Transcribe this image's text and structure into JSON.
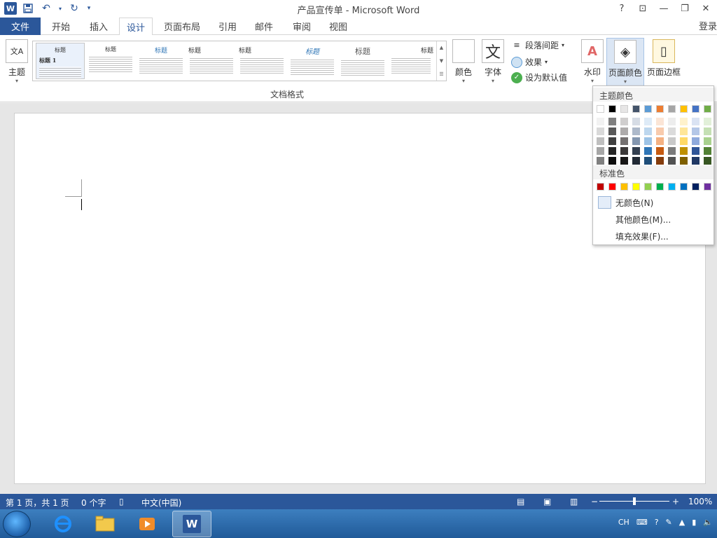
{
  "titlebar": {
    "title": "产品宣传单 - Microsoft Word",
    "app_badge": "W",
    "help": "?",
    "ribbon_display": "⊡",
    "minimize": "—",
    "restore": "❐",
    "close": "✕"
  },
  "tabs": {
    "file": "文件",
    "items": [
      "开始",
      "插入",
      "设计",
      "页面布局",
      "引用",
      "邮件",
      "审阅",
      "视图"
    ],
    "active_index": 2,
    "login": "登录"
  },
  "ribbon": {
    "theme_btn": "主题",
    "gallery_headings": [
      "标题",
      "标题",
      "标题",
      "标题",
      "标题",
      "标题",
      "标题",
      "标题",
      "标题"
    ],
    "gallery_sub": "标题 1",
    "group_label": "文档格式",
    "colors_btn": "颜色",
    "fonts_btn": "字体",
    "fonts_glyph": "文",
    "paragraph_spacing": "段落间距",
    "effects": "效果",
    "set_default": "设为默认值",
    "watermark": "水印",
    "page_color": "页面颜色",
    "page_border": "页面边框"
  },
  "dropdown": {
    "theme_colors_label": "主题颜色",
    "standard_colors_label": "标准色",
    "no_color": "无颜色(N)",
    "more_colors": "其他颜色(M)...",
    "fill_effects": "填充效果(F)...",
    "theme_top": [
      "#ffffff",
      "#000000",
      "#e7e6e6",
      "#44546a",
      "#5b9bd5",
      "#ed7d31",
      "#a5a5a5",
      "#ffc000",
      "#4472c4",
      "#70ad47"
    ],
    "theme_shades": [
      [
        "#f2f2f2",
        "#808080",
        "#d0cece",
        "#d6dce5",
        "#deebf7",
        "#fbe5d6",
        "#ededed",
        "#fff2cc",
        "#dae3f3",
        "#e2f0d9"
      ],
      [
        "#d9d9d9",
        "#595959",
        "#aeabab",
        "#adb9ca",
        "#bdd7ee",
        "#f8cbad",
        "#dbdbdb",
        "#ffe699",
        "#b4c7e7",
        "#c5e0b4"
      ],
      [
        "#bfbfbf",
        "#404040",
        "#757171",
        "#8497b0",
        "#9dc3e6",
        "#f4b183",
        "#c9c9c9",
        "#ffd966",
        "#8faadc",
        "#a9d18e"
      ],
      [
        "#a6a6a6",
        "#262626",
        "#3b3838",
        "#333f50",
        "#2e75b6",
        "#c55a11",
        "#7b7b7b",
        "#bf9000",
        "#2f5597",
        "#538135"
      ],
      [
        "#7f7f7f",
        "#0d0d0d",
        "#171616",
        "#222a35",
        "#1f4e79",
        "#843c0c",
        "#525252",
        "#7f6000",
        "#203864",
        "#385723"
      ]
    ],
    "standard": [
      "#c00000",
      "#ff0000",
      "#ffc000",
      "#ffff00",
      "#92d050",
      "#00b050",
      "#00b0f0",
      "#0070c0",
      "#002060",
      "#7030a0"
    ]
  },
  "statusbar": {
    "page_info": "第 1 页，共 1 页",
    "word_count": "0 个字",
    "language": "中文(中国)",
    "zoom_minus": "−",
    "zoom_plus": "+",
    "zoom": "100%"
  },
  "taskbar": {
    "tray_lang": "CH"
  },
  "colors": {
    "accent": "#2b579a"
  }
}
